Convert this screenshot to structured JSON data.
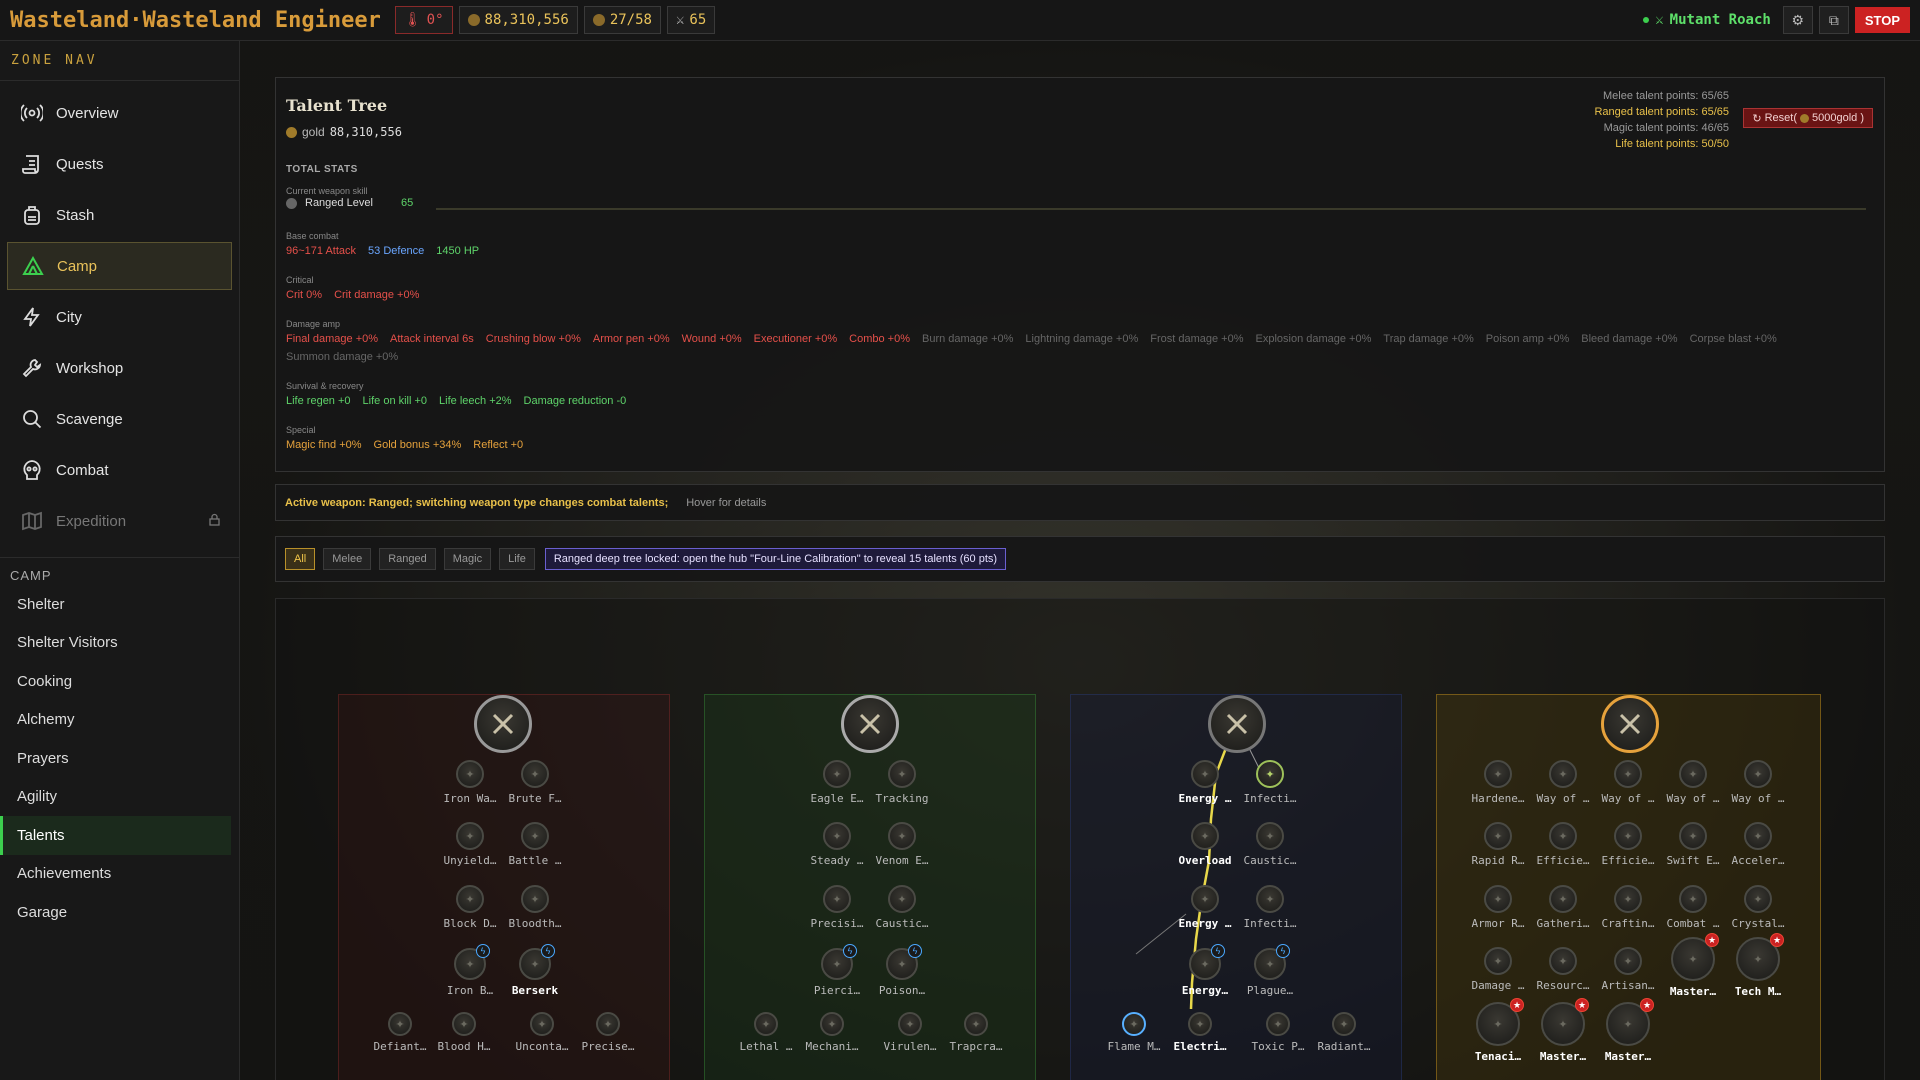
{
  "header": {
    "title": "Wasteland·Wasteland Engineer",
    "heat": "0°",
    "gold": "88,310,556",
    "capacity": "27/58",
    "power": "65",
    "status": "Mutant Roach",
    "stop_label": "STOP"
  },
  "sidebar": {
    "zone_nav_title": "ZONE NAV",
    "items": [
      {
        "label": "Overview"
      },
      {
        "label": "Quests"
      },
      {
        "label": "Stash"
      },
      {
        "label": "Camp"
      },
      {
        "label": "City"
      },
      {
        "label": "Workshop"
      },
      {
        "label": "Scavenge"
      },
      {
        "label": "Combat"
      },
      {
        "label": "Expedition"
      }
    ],
    "camp_title": "CAMP",
    "camp_items": [
      "Shelter",
      "Shelter Visitors",
      "Cooking",
      "Alchemy",
      "Prayers",
      "Agility",
      "Talents",
      "Achievements",
      "Garage"
    ]
  },
  "talent": {
    "title": "Talent Tree",
    "gold_label": "gold",
    "gold_value": "88,310,556",
    "points": {
      "melee": "Melee talent points: 65/65",
      "ranged": "Ranged talent points: 65/65",
      "magic": "Magic talent points: 46/65",
      "life": "Life talent points: 50/50"
    },
    "reset_label": "Reset(",
    "reset_cost": "5000gold )",
    "total_stats": "TOTAL STATS",
    "weapon_cat": "Current weapon skill",
    "weapon_label": "Ranged Level",
    "weapon_level": "65",
    "base_cat": "Base combat",
    "base": [
      "96~171 Attack",
      "53 Defence",
      "1450 HP"
    ],
    "crit_cat": "Critical",
    "crit": [
      "Crit 0%",
      "Crit damage +0%"
    ],
    "amp_cat": "Damage amp",
    "amp_active": [
      "Final damage +0%",
      "Attack interval 6s",
      "Crushing blow +0%",
      "Armor pen +0%",
      "Wound +0%",
      "Executioner +0%",
      "Combo +0%"
    ],
    "amp_inactive": [
      "Burn damage +0%",
      "Lightning damage +0%",
      "Frost damage +0%",
      "Explosion damage +0%",
      "Trap damage +0%",
      "Poison amp +0%",
      "Bleed damage +0%",
      "Corpse blast +0%"
    ],
    "amp_inactive2": "Summon damage +0%",
    "surv_cat": "Survival & recovery",
    "surv": [
      "Life regen +0",
      "Life on kill +0",
      "Life leech +2%",
      "Damage reduction -0"
    ],
    "special_cat": "Special",
    "special": [
      "Magic find +0%",
      "Gold bonus +34%",
      "Reflect +0"
    ]
  },
  "active_weapon": {
    "text": "Active weapon: Ranged; switching weapon type changes combat talents;",
    "hover": "Hover for details"
  },
  "filters": {
    "tabs": [
      "All",
      "Melee",
      "Ranged",
      "Magic",
      "Life"
    ],
    "lock_note": "Ranged deep tree locked: open the hub \"Four-Line Calibration\" to reveal 15 talents (60 pts)"
  },
  "tree": {
    "melee": [
      "Iron Wa…",
      "Brute F…",
      "Unyield…",
      "Battle …",
      "Block D…",
      "Bloodth…",
      "Iron B…",
      "Berserk",
      "Defiant…",
      "Blood H…",
      "Unconta…",
      "Precise…"
    ],
    "ranged": [
      "Eagle E…",
      "Tracking",
      "Steady …",
      "Venom E…",
      "Precisi…",
      "Caustic…",
      "Pierci…",
      "Poison…",
      "Lethal …",
      "Mechani…",
      "Virulen…",
      "Trapcra…"
    ],
    "magic": [
      "Energy …",
      "Infecti…",
      "Overload",
      "Caustic…",
      "Energy …",
      "Infecti…",
      "Energy…",
      "Plague…",
      "Flame M…",
      "Electri…",
      "Toxic P…",
      "Radiant…"
    ],
    "life": [
      "Hardene…",
      "Way of …",
      "Way of …",
      "Way of …",
      "Way of …",
      "Rapid R…",
      "Efficie…",
      "Efficie…",
      "Swift E…",
      "Acceler…",
      "Armor R…",
      "Gatheri…",
      "Craftin…",
      "Combat …",
      "Crystal…",
      "Damage …",
      "Resourc…",
      "Artisan…",
      "Master…",
      "Tech M…",
      "Tenaci…",
      "Master…",
      "Master…"
    ]
  },
  "colors": {
    "accent": "#d89b3a",
    "success": "#3ccf4e",
    "danger": "#cc2222"
  }
}
